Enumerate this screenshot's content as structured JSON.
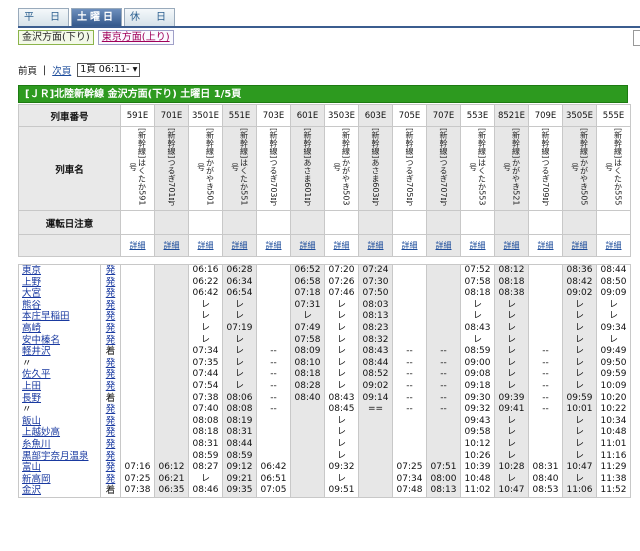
{
  "tabs": [
    "平　日",
    "土曜日",
    "休　日"
  ],
  "active_tab": 1,
  "directions": [
    "金沢方面(下り)",
    "東京方面(上り)"
  ],
  "pager": {
    "prev": "前頁",
    "sep": "|",
    "next": "次頁",
    "select": "1頁 06:11- ▾"
  },
  "band_title": "[ＪＲ]北陸新幹線 金沢方面(下り) 土曜日 1/5頁",
  "labels": {
    "number": "列車番号",
    "name": "列車名",
    "note": "運転日注意",
    "detail": "詳細"
  },
  "trains": [
    {
      "no": "591E",
      "name": "[新幹線]はくたか591号",
      "gray": false
    },
    {
      "no": "701E",
      "name": "[新幹線]つるぎ701号",
      "gray": true
    },
    {
      "no": "3501E",
      "name": "[新幹線]かがやき501号",
      "gray": false
    },
    {
      "no": "551E",
      "name": "[新幹線]はくたか551号",
      "gray": true
    },
    {
      "no": "703E",
      "name": "[新幹線]つるぎ703号",
      "gray": false
    },
    {
      "no": "601E",
      "name": "[新幹線]あさま601号",
      "gray": true
    },
    {
      "no": "3503E",
      "name": "[新幹線]かがやき503号",
      "gray": false
    },
    {
      "no": "603E",
      "name": "[新幹線]あさま603号",
      "gray": true
    },
    {
      "no": "705E",
      "name": "[新幹線]つるぎ705号",
      "gray": false
    },
    {
      "no": "707E",
      "name": "[新幹線]つるぎ707号",
      "gray": true
    },
    {
      "no": "553E",
      "name": "[新幹線]はくたか553号",
      "gray": false
    },
    {
      "no": "8521E",
      "name": "[新幹線]かがやき521号",
      "gray": true
    },
    {
      "no": "709E",
      "name": "[新幹線]つるぎ709号",
      "gray": false
    },
    {
      "no": "3505E",
      "name": "[新幹線]かがやき505号",
      "gray": true
    },
    {
      "no": "555E",
      "name": "[新幹線]はくたか555号",
      "gray": false
    }
  ],
  "stations": [
    {
      "name": "東京",
      "mark": "発",
      "link": true
    },
    {
      "name": "上野",
      "mark": "発",
      "link": true
    },
    {
      "name": "大宮",
      "mark": "発",
      "link": true
    },
    {
      "name": "熊谷",
      "mark": "発",
      "link": true
    },
    {
      "name": "本庄早稲田",
      "mark": "発",
      "link": true
    },
    {
      "name": "高崎",
      "mark": "発",
      "link": true
    },
    {
      "name": "安中榛名",
      "mark": "発",
      "link": true
    },
    {
      "name": "軽井沢",
      "mark": "着",
      "link": true
    },
    {
      "name": "〃",
      "mark": "発",
      "link": false
    },
    {
      "name": "佐久平",
      "mark": "発",
      "link": true
    },
    {
      "name": "上田",
      "mark": "発",
      "link": true
    },
    {
      "name": "長野",
      "mark": "着",
      "link": true
    },
    {
      "name": "〃",
      "mark": "発",
      "link": false
    },
    {
      "name": "飯山",
      "mark": "発",
      "link": true
    },
    {
      "name": "上越妙高",
      "mark": "発",
      "link": true
    },
    {
      "name": "糸魚川",
      "mark": "発",
      "link": true
    },
    {
      "name": "黒部宇奈月温泉",
      "mark": "発",
      "link": true
    },
    {
      "name": "富山",
      "mark": "発",
      "link": true
    },
    {
      "name": "新高岡",
      "mark": "発",
      "link": true
    },
    {
      "name": "金沢",
      "mark": "着",
      "link": true
    }
  ],
  "times": [
    [
      "",
      "",
      "",
      "",
      "",
      "",
      "",
      "",
      "",
      "",
      "",
      "",
      "",
      "",
      "",
      "",
      "",
      "07:16",
      "07:25",
      "07:38"
    ],
    [
      "",
      "",
      "",
      "",
      "",
      "",
      "",
      "",
      "",
      "",
      "",
      "",
      "",
      "",
      "",
      "",
      "",
      "06:12",
      "06:21",
      "06:35"
    ],
    [
      "06:16",
      "06:22",
      "06:42",
      "レ",
      "レ",
      "レ",
      "レ",
      "07:34",
      "07:35",
      "07:44",
      "07:54",
      "07:38",
      "07:40",
      "08:08",
      "08:18",
      "08:31",
      "08:59",
      "08:27",
      "レ",
      "08:46"
    ],
    [
      "06:28",
      "06:34",
      "06:54",
      "レ",
      "レ",
      "07:19",
      "レ",
      "レ",
      "レ",
      "レ",
      "レ",
      "08:06",
      "08:08",
      "08:19",
      "08:31",
      "08:44",
      "08:59",
      "09:12",
      "09:21",
      "09:35"
    ],
    [
      "",
      "",
      "",
      "",
      "",
      "",
      "",
      "--",
      "--",
      "--",
      "--",
      "--",
      "--",
      "",
      "",
      "",
      "",
      "06:42",
      "06:51",
      "07:05"
    ],
    [
      "06:52",
      "06:58",
      "07:18",
      "07:31",
      "レ",
      "07:49",
      "07:58",
      "08:09",
      "08:10",
      "08:18",
      "08:28",
      "08:40",
      "",
      "",
      "",
      "",
      "",
      "",
      "",
      ""
    ],
    [
      "07:20",
      "07:26",
      "07:46",
      "レ",
      "レ",
      "レ",
      "レ",
      "レ",
      "レ",
      "レ",
      "レ",
      "08:43",
      "08:45",
      "レ",
      "レ",
      "レ",
      "レ",
      "09:32",
      "レ",
      "09:51"
    ],
    [
      "07:24",
      "07:30",
      "07:50",
      "08:03",
      "08:13",
      "08:23",
      "08:32",
      "08:43",
      "08:44",
      "08:52",
      "09:02",
      "09:14",
      "==",
      "",
      "",
      "",
      "",
      "",
      "",
      ""
    ],
    [
      "",
      "",
      "",
      "",
      "",
      "",
      "",
      "--",
      "--",
      "--",
      "--",
      "--",
      "--",
      "",
      "",
      "",
      "",
      "07:25",
      "07:34",
      "07:48"
    ],
    [
      "",
      "",
      "",
      "",
      "",
      "",
      "",
      "--",
      "--",
      "--",
      "--",
      "--",
      "--",
      "",
      "",
      "",
      "",
      "07:51",
      "08:00",
      "08:13"
    ],
    [
      "07:52",
      "07:58",
      "08:18",
      "レ",
      "レ",
      "08:43",
      "レ",
      "08:59",
      "09:00",
      "09:08",
      "09:18",
      "09:30",
      "09:32",
      "09:43",
      "09:58",
      "10:12",
      "10:26",
      "10:39",
      "10:48",
      "11:02"
    ],
    [
      "08:12",
      "08:18",
      "08:38",
      "レ",
      "レ",
      "レ",
      "レ",
      "レ",
      "レ",
      "レ",
      "レ",
      "09:39",
      "09:41",
      "レ",
      "レ",
      "レ",
      "レ",
      "10:28",
      "レ",
      "10:47"
    ],
    [
      "",
      "",
      "",
      "",
      "",
      "",
      "",
      "--",
      "--",
      "--",
      "--",
      "--",
      "--",
      "",
      "",
      "",
      "",
      "08:31",
      "08:40",
      "08:53"
    ],
    [
      "08:36",
      "08:42",
      "09:02",
      "レ",
      "レ",
      "レ",
      "レ",
      "レ",
      "レ",
      "レ",
      "レ",
      "09:59",
      "10:01",
      "レ",
      "レ",
      "レ",
      "レ",
      "10:47",
      "レ",
      "11:06"
    ],
    [
      "08:44",
      "08:50",
      "09:09",
      "レ",
      "レ",
      "09:34",
      "レ",
      "09:49",
      "09:50",
      "09:59",
      "10:09",
      "10:20",
      "10:22",
      "10:34",
      "10:48",
      "11:01",
      "11:16",
      "11:29",
      "11:38",
      "11:52"
    ]
  ]
}
